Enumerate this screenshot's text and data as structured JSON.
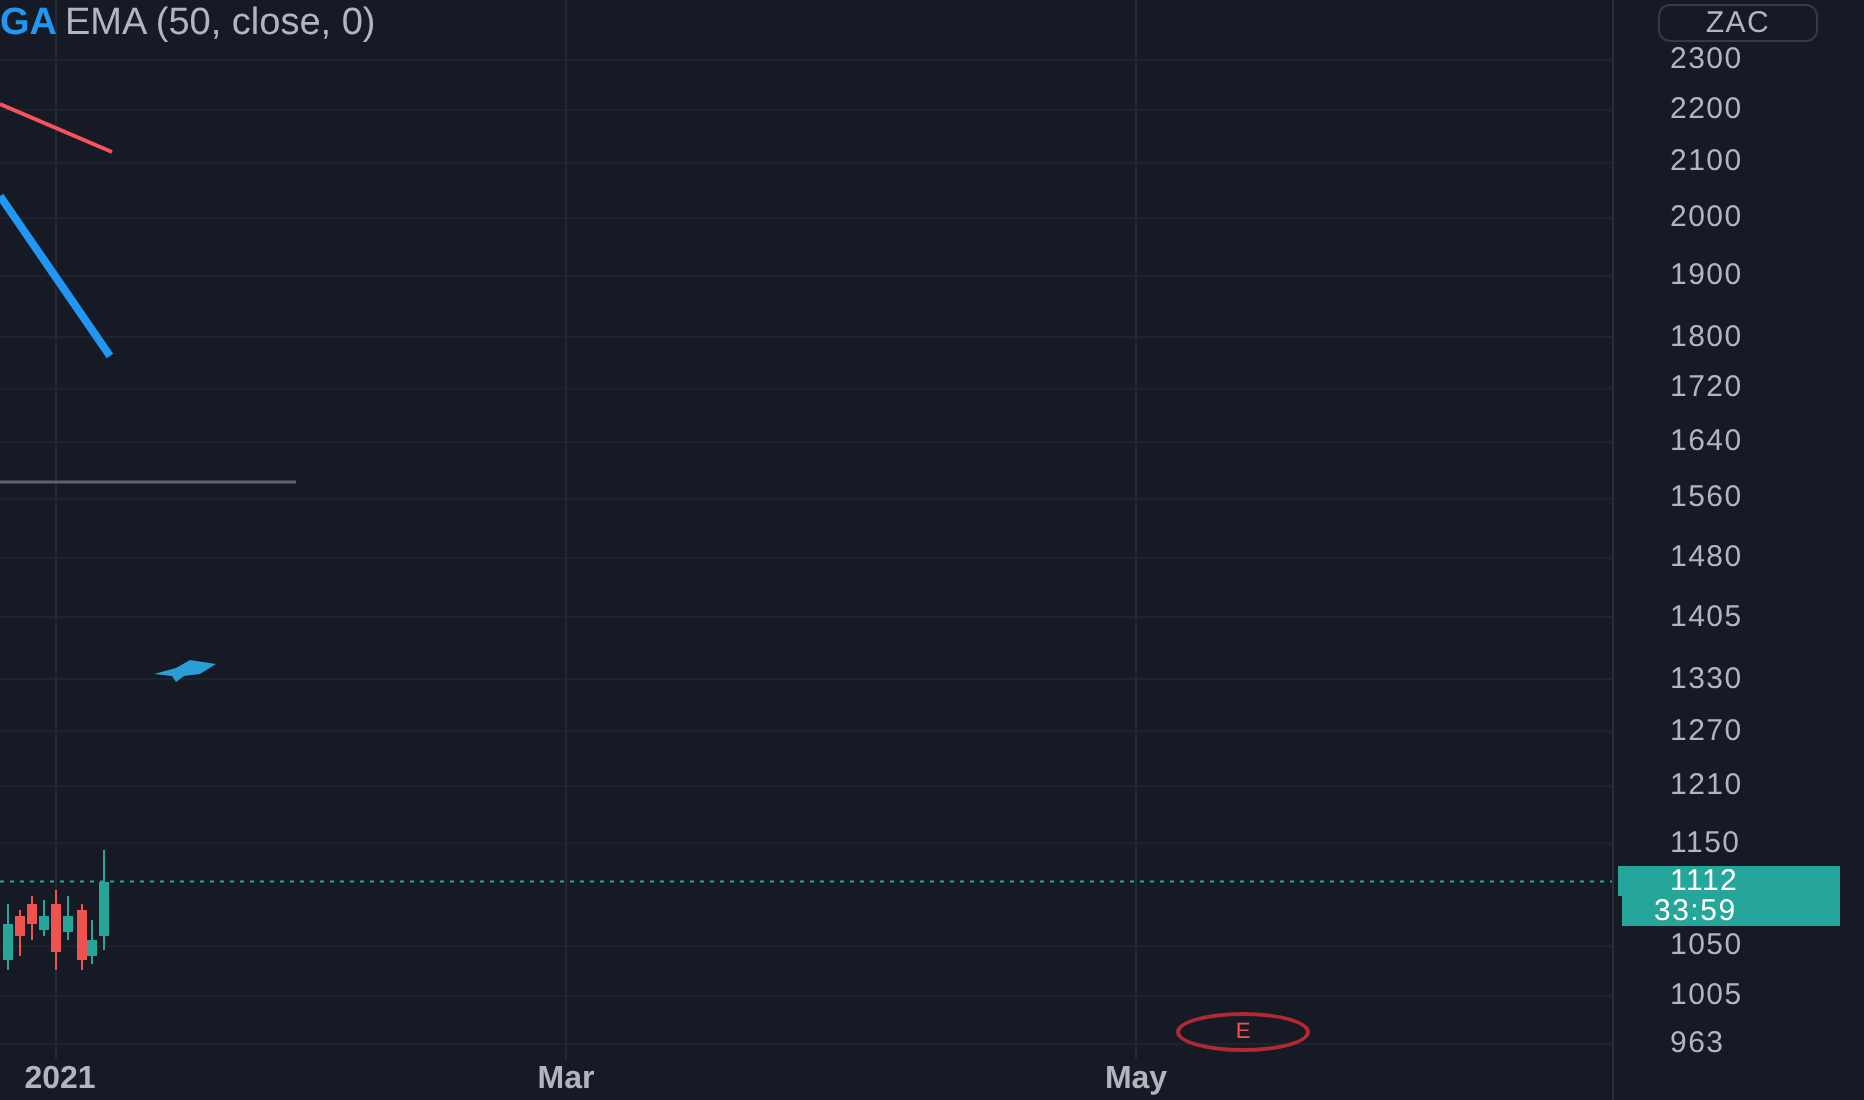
{
  "legend": {
    "prefix": "GA",
    "study": "EMA (50, close, 0)"
  },
  "price_axis": {
    "currency": "ZAC",
    "ticks": [
      "2300",
      "2200",
      "2100",
      "2000",
      "1900",
      "1800",
      "1720",
      "1640",
      "1560",
      "1480",
      "1405",
      "1330",
      "1270",
      "1210",
      "1150",
      "1050",
      "1005",
      "963"
    ],
    "last_price": "1112",
    "countdown": "33:59"
  },
  "time_axis": {
    "labels": [
      "2021",
      "Mar",
      "May"
    ]
  },
  "events": [
    {
      "label": "E"
    }
  ]
}
